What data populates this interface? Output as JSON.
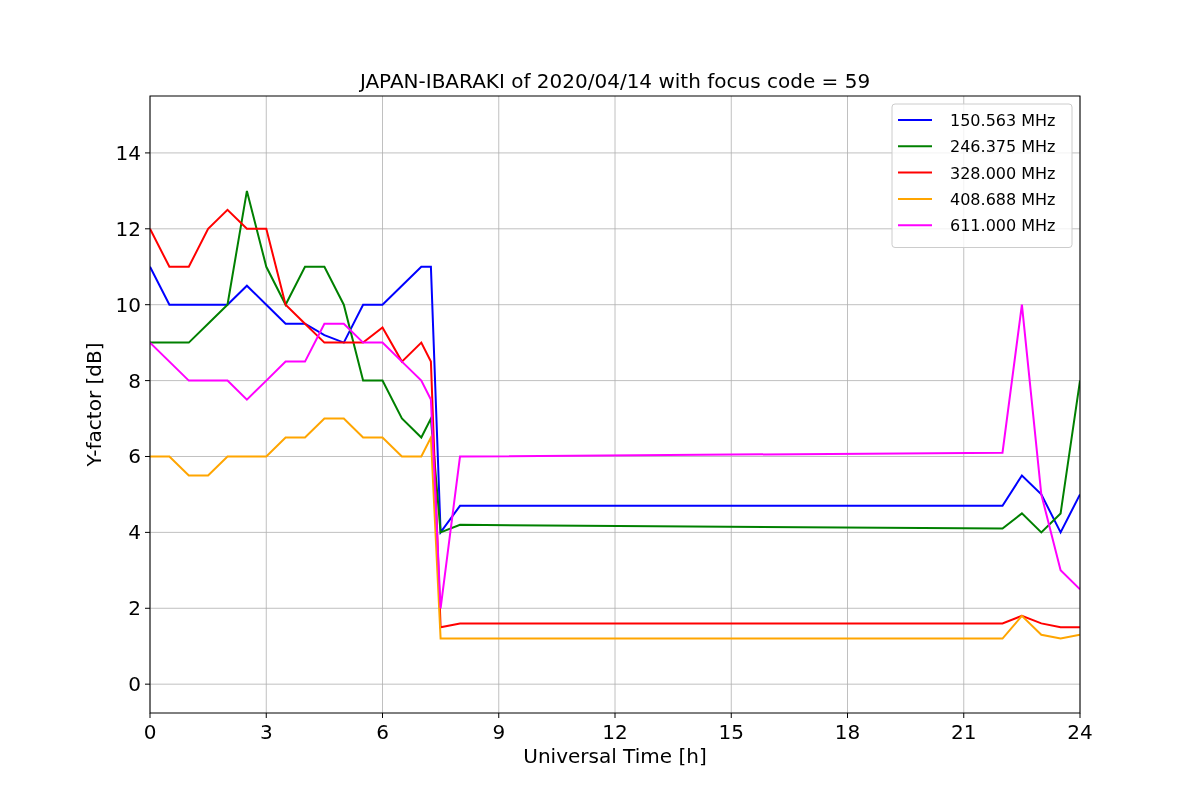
{
  "chart_data": {
    "type": "line",
    "title": "JAPAN-IBARAKI of 2020/04/14 with focus code = 59",
    "xlabel": "Universal Time [h]",
    "ylabel": "Y-factor [dB]",
    "x": [
      0,
      0.5,
      1,
      1.5,
      2,
      2.5,
      3,
      3.5,
      4,
      4.5,
      5,
      5.5,
      6,
      6.5,
      7,
      7.25,
      7.5,
      8,
      22,
      22.5,
      23,
      23.5,
      24
    ],
    "series": [
      {
        "name": "150.563 MHz",
        "color": "#0000ff",
        "values": [
          11,
          10,
          10,
          10,
          10,
          10.5,
          10,
          9.5,
          9.5,
          9.2,
          9,
          10,
          10,
          10.5,
          11,
          11,
          4,
          4.7,
          4.7,
          5.5,
          5,
          4,
          5
        ]
      },
      {
        "name": "246.375 MHz",
        "color": "#008000",
        "values": [
          9,
          9,
          9,
          9.5,
          10,
          13,
          11,
          10,
          11,
          11,
          10,
          8,
          8,
          7,
          6.5,
          7,
          4,
          4.2,
          4.1,
          4.5,
          4,
          4.5,
          8
        ]
      },
      {
        "name": "328.000 MHz",
        "color": "#ff0000",
        "values": [
          12,
          11,
          11,
          12,
          12.5,
          12,
          12,
          10,
          9.5,
          9,
          9,
          9,
          9.4,
          8.5,
          9,
          8.5,
          1.5,
          1.6,
          1.6,
          1.8,
          1.6,
          1.5,
          1.5
        ]
      },
      {
        "name": "408.688 MHz",
        "color": "#ffa500",
        "values": [
          6,
          6,
          5.5,
          5.5,
          6,
          6,
          6,
          6.5,
          6.5,
          7,
          7,
          6.5,
          6.5,
          6,
          6,
          6.5,
          1.2,
          1.2,
          1.2,
          1.8,
          1.3,
          1.2,
          1.3
        ]
      },
      {
        "name": "611.000 MHz",
        "color": "#ff00ff",
        "values": [
          9,
          8.5,
          8,
          8,
          8,
          7.5,
          8,
          8.5,
          8.5,
          9.5,
          9.5,
          9,
          9,
          8.5,
          8,
          7.5,
          2,
          6,
          6.1,
          10,
          5,
          3,
          2.5
        ]
      }
    ],
    "xlim": [
      0,
      24
    ],
    "ylim": [
      -0.76,
      15.5
    ],
    "xticks": [
      0,
      3,
      6,
      9,
      12,
      15,
      18,
      21,
      24
    ],
    "yticks": [
      0,
      2,
      4,
      6,
      8,
      10,
      12,
      14
    ],
    "grid": true,
    "legend": true
  }
}
